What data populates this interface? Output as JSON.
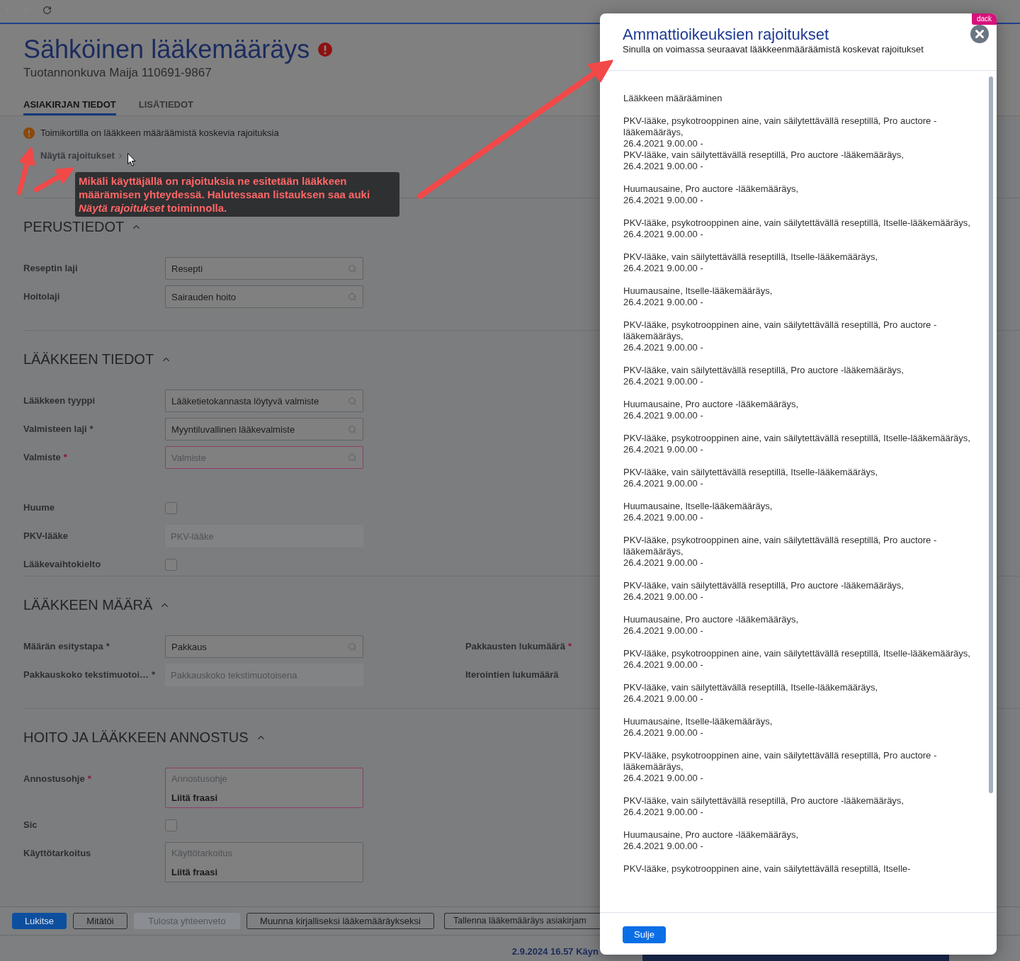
{
  "page": {
    "title": "Sähköinen lääkemääräys",
    "has_error": true,
    "subtitle": "Tuotannonkuva Maija 110691-9867"
  },
  "tabs": [
    {
      "label": "ASIAKIRJAN TIEDOT",
      "selected": true
    },
    {
      "label": "LISÄTIEDOT",
      "selected": false
    }
  ],
  "restriction_notice": {
    "text": "Toimikortilla on lääkkeen määräämistä koskevia rajoituksia",
    "link": "Näytä rajoitukset"
  },
  "annotation": {
    "text": "Mikäli käyttäjällä on rajoituksia ne esitetään lääkkeen määrämisen yhteydessä. Halutessaan listauksen saa auki *Näytä rajoitukset* toiminnolla."
  },
  "sections": [
    {
      "title": "PERUSTIEDOT",
      "expanded": true,
      "groups": [
        [
          {
            "label": "Reseptin laji",
            "kind": "lookup",
            "value": "Resepti",
            "invalid": false
          },
          {
            "label": "Hoitolaji",
            "kind": "lookup",
            "value": "Sairauden hoito",
            "invalid": false
          }
        ]
      ]
    },
    {
      "title": "LÄÄKKEEN TIEDOT",
      "expanded": true,
      "groups": [
        [
          {
            "label": "Lääkkeen tyyppi",
            "kind": "lookup",
            "value": "Lääketietokannasta löytyvä valmiste",
            "invalid": false
          },
          {
            "label": "Valmisteen laji",
            "required_mark": "*",
            "kind": "lookup",
            "value": "Myyntiluvallinen lääkevalmiste",
            "invalid": false
          },
          {
            "label": "Valmiste",
            "required_mark": "*",
            "kind": "lookup",
            "placeholder": "Valmiste",
            "invalid": true
          }
        ],
        [
          {
            "label": "Huume",
            "kind": "checkbox",
            "checked": false
          },
          {
            "label": "PKV-lääke",
            "kind": "text",
            "placeholder": "PKV-lääke",
            "disabled": true
          },
          {
            "label": "Lääkevaihtokielto",
            "kind": "checkbox",
            "checked": false
          }
        ]
      ]
    },
    {
      "title": "LÄÄKKEEN MÄÄRÄ",
      "expanded": true,
      "groups": [
        [
          {
            "label": "Määrän esitystapa",
            "required_mark": "*",
            "kind": "lookup",
            "value": "Pakkaus",
            "invalid": false,
            "side_label": {
              "label": "Pakkausten lukumäärä",
              "required_mark": "*",
              "invalid": true
            }
          },
          {
            "label": "Pakkauskoko tekstimuotoi…",
            "required_mark": "*",
            "kind": "text",
            "placeholder": "Pakkauskoko tekstimuotoisena",
            "disabled": true,
            "side_label": {
              "label": "Iterointien lukumäärä"
            }
          }
        ]
      ]
    },
    {
      "title": "HOITO JA LÄÄKKEEN ANNOSTUS",
      "expanded": true,
      "groups": [
        [
          {
            "label": "Annostusohje",
            "required_mark": "*",
            "kind": "textarea",
            "placeholder": "Annostusohje",
            "action": "Liitä fraasi",
            "invalid": true
          },
          {
            "label": "Sic",
            "kind": "checkbox",
            "checked": false
          },
          {
            "label": "Käyttötarkoitus",
            "kind": "textarea",
            "placeholder": "Käyttötarkoitus",
            "action": "Liitä fraasi",
            "invalid": false
          }
        ]
      ]
    }
  ],
  "actions": [
    {
      "label": "Lukitse",
      "kind": "primary",
      "disabled": false
    },
    {
      "label": "Mitätöi",
      "kind": "secondary",
      "disabled": false
    },
    {
      "label": "Tulosta yhteenveto",
      "kind": "secondary",
      "disabled": true
    },
    {
      "label": "Muunna kirjalliseksi lääkemääräykseksi",
      "kind": "secondary",
      "disabled": false
    },
    {
      "label": "Tallenna lääkemääräys asiakirjam",
      "kind": "secondary",
      "disabled": false
    }
  ],
  "status_bar": {
    "text": "2.9.2024 16.57 Käyn"
  },
  "dialog": {
    "title": "Ammattioikeuksien rajoitukset",
    "subtitle": "Sinulla on voimassa seuraavat lääkkeenmääräämistä koskevat rajoitukset",
    "badge": "dack",
    "heading": "Lääkkeen määrääminen",
    "groups": [
      [
        {
          "text": "PKV-lääke, psykotrooppinen aine, vain säilytettävällä reseptillä, Pro auctore -lääkemääräys,",
          "period": "26.4.2021 9.00.00 -"
        },
        {
          "text": "PKV-lääke, vain säilytettävällä reseptillä, Pro auctore -lääkemääräys,",
          "period": "26.4.2021 9.00.00 -"
        }
      ],
      [
        {
          "text": "Huumausaine, Pro auctore -lääkemääräys,",
          "period": "26.4.2021 9.00.00 -"
        }
      ],
      [
        {
          "text": "PKV-lääke, psykotrooppinen aine, vain säilytettävällä reseptillä, Itselle-lääkemääräys,",
          "period": "26.4.2021 9.00.00 -"
        }
      ],
      [
        {
          "text": "PKV-lääke, vain säilytettävällä reseptillä, Itselle-lääkemääräys,",
          "period": "26.4.2021 9.00.00 -"
        }
      ],
      [
        {
          "text": "Huumausaine, Itselle-lääkemääräys,",
          "period": "26.4.2021 9.00.00 -"
        }
      ],
      [
        {
          "text": "PKV-lääke, psykotrooppinen aine, vain säilytettävällä reseptillä, Pro auctore -lääkemääräys,",
          "period": "26.4.2021 9.00.00 -"
        }
      ],
      [
        {
          "text": "PKV-lääke, vain säilytettävällä reseptillä, Pro auctore -lääkemääräys,",
          "period": "26.4.2021 9.00.00 -"
        }
      ],
      [
        {
          "text": "Huumausaine, Pro auctore -lääkemääräys,",
          "period": "26.4.2021 9.00.00 -"
        }
      ],
      [
        {
          "text": "PKV-lääke, psykotrooppinen aine, vain säilytettävällä reseptillä, Itselle-lääkemääräys,",
          "period": "26.4.2021 9.00.00 -"
        }
      ],
      [
        {
          "text": "PKV-lääke, vain säilytettävällä reseptillä, Itselle-lääkemääräys,",
          "period": "26.4.2021 9.00.00 -"
        }
      ],
      [
        {
          "text": "Huumausaine, Itselle-lääkemääräys,",
          "period": "26.4.2021 9.00.00 -"
        }
      ],
      [
        {
          "text": "PKV-lääke, psykotrooppinen aine, vain säilytettävällä reseptillä, Pro auctore -lääkemääräys,",
          "period": "26.4.2021 9.00.00 -"
        }
      ],
      [
        {
          "text": "PKV-lääke, vain säilytettävällä reseptillä, Pro auctore -lääkemääräys,",
          "period": "26.4.2021 9.00.00 -"
        }
      ],
      [
        {
          "text": "Huumausaine, Pro auctore -lääkemääräys,",
          "period": "26.4.2021 9.00.00 -"
        }
      ],
      [
        {
          "text": "PKV-lääke, psykotrooppinen aine, vain säilytettävällä reseptillä, Itselle-lääkemääräys,",
          "period": "26.4.2021 9.00.00 -"
        }
      ],
      [
        {
          "text": "PKV-lääke, vain säilytettävällä reseptillä, Itselle-lääkemääräys,",
          "period": "26.4.2021 9.00.00 -"
        }
      ],
      [
        {
          "text": "Huumausaine, Itselle-lääkemääräys,",
          "period": "26.4.2021 9.00.00 -"
        }
      ],
      [
        {
          "text": "PKV-lääke, psykotrooppinen aine, vain säilytettävällä reseptillä, Pro auctore -lääkemääräys,",
          "period": "26.4.2021 9.00.00 -"
        }
      ],
      [
        {
          "text": "PKV-lääke, vain säilytettävällä reseptillä, Pro auctore -lääkemääräys,",
          "period": "26.4.2021 9.00.00 -"
        }
      ],
      [
        {
          "text": "Huumausaine, Pro auctore -lääkemääräys,",
          "period": "26.4.2021 9.00.00 -"
        }
      ],
      [
        {
          "text": "PKV-lääke, psykotrooppinen aine, vain säilytettävällä reseptillä, Itselle-"
        }
      ]
    ],
    "close_label": "Sulje"
  }
}
